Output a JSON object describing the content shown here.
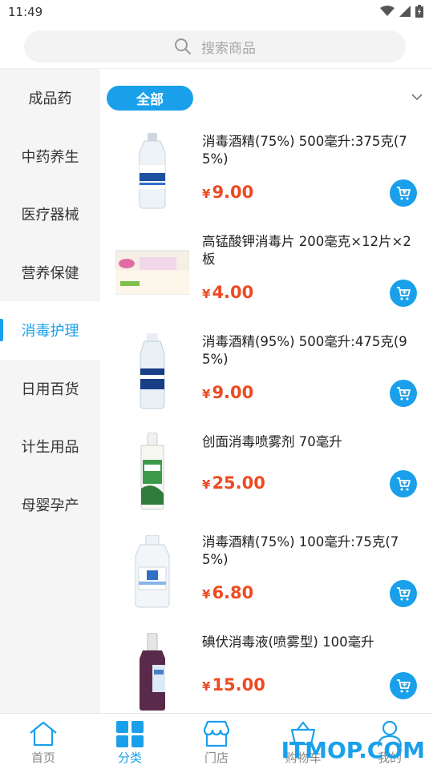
{
  "status_bar": {
    "time": "11:49"
  },
  "search": {
    "placeholder": "搜索商品"
  },
  "sidebar": {
    "items": [
      {
        "label": "成品药"
      },
      {
        "label": "中药养生"
      },
      {
        "label": "医疗器械"
      },
      {
        "label": "营养保健"
      },
      {
        "label": "消毒护理",
        "active": true
      },
      {
        "label": "日用百货"
      },
      {
        "label": "计生用品"
      },
      {
        "label": "母婴孕产"
      }
    ]
  },
  "filter": {
    "all_label": "全部"
  },
  "products": [
    {
      "name": "消毒酒精(75%) 500毫升:375克(75%)",
      "currency": "¥",
      "price": "9.00"
    },
    {
      "name": "高锰酸钾消毒片 200毫克×12片×2板",
      "currency": "¥",
      "price": "4.00"
    },
    {
      "name": "消毒酒精(95%) 500毫升:475克(95%)",
      "currency": "¥",
      "price": "9.00"
    },
    {
      "name": "创面消毒喷雾剂 70毫升",
      "currency": "¥",
      "price": "25.00"
    },
    {
      "name": "消毒酒精(75%) 100毫升:75克(75%)",
      "currency": "¥",
      "price": "6.80"
    },
    {
      "name": "碘伏消毒液(喷雾型) 100毫升",
      "currency": "¥",
      "price": "15.00"
    }
  ],
  "tabbar": {
    "items": [
      {
        "label": "首页",
        "icon": "home-icon"
      },
      {
        "label": "分类",
        "icon": "category-icon",
        "active": true
      },
      {
        "label": "门店",
        "icon": "store-icon"
      },
      {
        "label": "购物车",
        "icon": "cart-icon"
      },
      {
        "label": "我的",
        "icon": "user-icon"
      }
    ]
  },
  "watermark": "ITMOP.COM",
  "colors": {
    "accent": "#1aa0ea",
    "price": "#ee4a22"
  }
}
